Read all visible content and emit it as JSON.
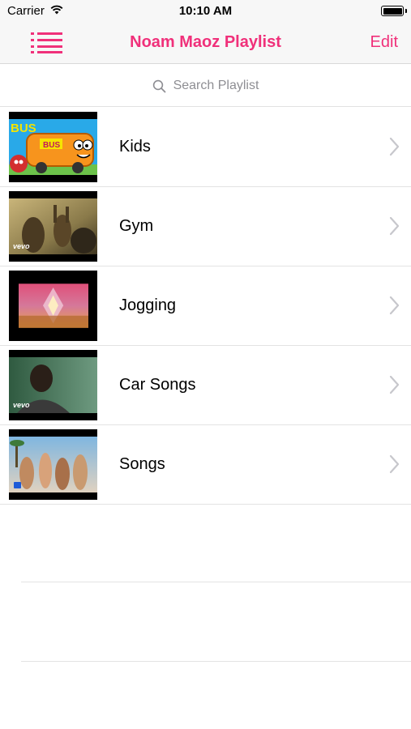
{
  "status_bar": {
    "carrier": "Carrier",
    "time": "10:10 AM"
  },
  "nav": {
    "title": "Noam Maoz Playlist",
    "edit_label": "Edit",
    "accent_color": "#f0307a"
  },
  "search": {
    "placeholder": "Search Playlist"
  },
  "playlists": [
    {
      "label": "Kids",
      "thumbnail": "cartoon-bus-thumbnail"
    },
    {
      "label": "Gym",
      "thumbnail": "concert-crowd-vevo-thumbnail"
    },
    {
      "label": "Jogging",
      "thumbnail": "abstract-album-art-thumbnail"
    },
    {
      "label": "Car Songs",
      "thumbnail": "singer-closeup-vevo-thumbnail"
    },
    {
      "label": "Songs",
      "thumbnail": "beach-party-thumbnail"
    }
  ]
}
